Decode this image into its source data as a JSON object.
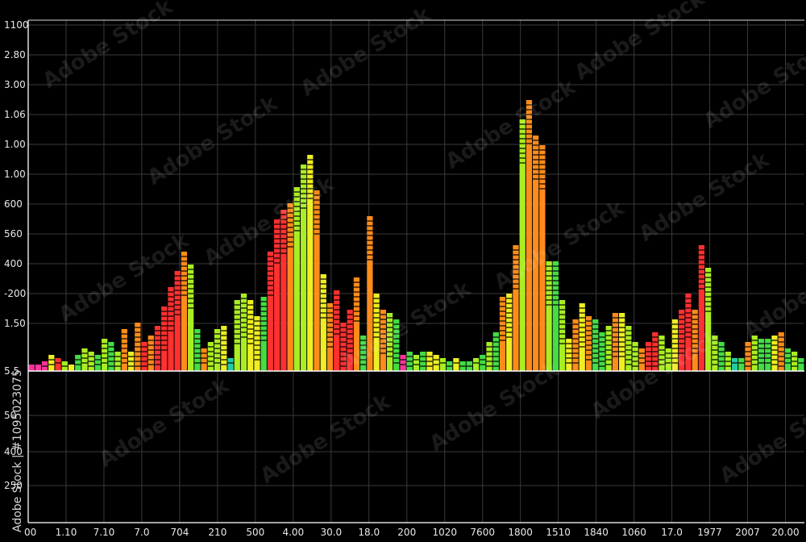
{
  "chart_data": {
    "type": "bar",
    "title": "",
    "xlabel": "",
    "ylabel": "",
    "grid": true,
    "background": "#000000",
    "ylim": [
      0,
      100
    ],
    "y_tick_labels": [
      "1100",
      "2.80",
      "3.00",
      "1.06",
      "1.00",
      "1.00",
      "600",
      "560",
      "400",
      "-200",
      "1.50",
      "5.5",
      "50",
      "400",
      "250"
    ],
    "x_tick_labels": [
      "00",
      "1.10",
      "7.10",
      "7.0",
      "704",
      "210",
      "500",
      "4.00",
      "30.0",
      "18.0",
      "200",
      "1020",
      "7600",
      "1800",
      "1510",
      "1840",
      "1060",
      "17.0",
      "1977",
      "2007",
      "20.00"
    ],
    "colors": {
      "green": "#44dd44",
      "lime": "#aaee22",
      "yellow": "#eeee22",
      "orange": "#ff8c1a",
      "red": "#ff3030",
      "teal": "#22ccaa",
      "magenta": "#ff3399",
      "grid": "#3a3a3a",
      "axis": "#dddddd"
    },
    "values": [
      2,
      2,
      3,
      5,
      4,
      3,
      2,
      5,
      7,
      6,
      5,
      10,
      9,
      6,
      13,
      6,
      15,
      9,
      11,
      14,
      20,
      26,
      31,
      37,
      33,
      13,
      7,
      9,
      13,
      14,
      4,
      22,
      24,
      22,
      17,
      23,
      37,
      47,
      50,
      52,
      57,
      64,
      67,
      56,
      30,
      21,
      25,
      15,
      19,
      29,
      11,
      48,
      24,
      19,
      18,
      16,
      5,
      6,
      5,
      6,
      6,
      5,
      4,
      3,
      4,
      3,
      3,
      4,
      5,
      9,
      12,
      23,
      24,
      39,
      78,
      84,
      73,
      70,
      34,
      34,
      22,
      10,
      16,
      21,
      17,
      16,
      12,
      14,
      18,
      18,
      14,
      9,
      7,
      9,
      12,
      11,
      7,
      16,
      19,
      24,
      19,
      39,
      32,
      11,
      9,
      6,
      4,
      4,
      9,
      11,
      10,
      10,
      11,
      12,
      7,
      6,
      4
    ],
    "bar_colors": [
      "magenta",
      "magenta",
      "magenta",
      "yellow",
      "red",
      "lime",
      "yellow",
      "green",
      "lime",
      "lime",
      "green",
      "lime",
      "green",
      "lime",
      "orange",
      "yellow",
      "orange",
      "red",
      "orange",
      "red",
      "red",
      "red",
      "red",
      "orange",
      "lime",
      "green",
      "orange",
      "lime",
      "lime",
      "yellow",
      "teal",
      "lime",
      "lime",
      "yellow",
      "yellow",
      "green",
      "red",
      "red",
      "red",
      "orange",
      "lime",
      "lime",
      "yellow",
      "orange",
      "yellow",
      "orange",
      "red",
      "red",
      "red",
      "orange",
      "green",
      "orange",
      "yellow",
      "orange",
      "lime",
      "green",
      "magenta",
      "green",
      "lime",
      "green",
      "yellow",
      "yellow",
      "lime",
      "green",
      "yellow",
      "green",
      "green",
      "lime",
      "green",
      "lime",
      "green",
      "orange",
      "yellow",
      "orange",
      "lime",
      "orange",
      "orange",
      "orange",
      "lime",
      "green",
      "lime",
      "yellow",
      "orange",
      "yellow",
      "orange",
      "green",
      "green",
      "lime",
      "orange",
      "yellow",
      "lime",
      "lime",
      "orange",
      "red",
      "red",
      "lime",
      "lime",
      "yellow",
      "red",
      "red",
      "orange",
      "red",
      "lime",
      "lime",
      "green",
      "lime",
      "teal",
      "green",
      "orange",
      "lime",
      "green",
      "green",
      "yellow",
      "orange",
      "green",
      "lime",
      "green"
    ]
  },
  "watermark": {
    "text": "Adobe Stock",
    "side_text": "Adobe Stock | #1095023075"
  }
}
